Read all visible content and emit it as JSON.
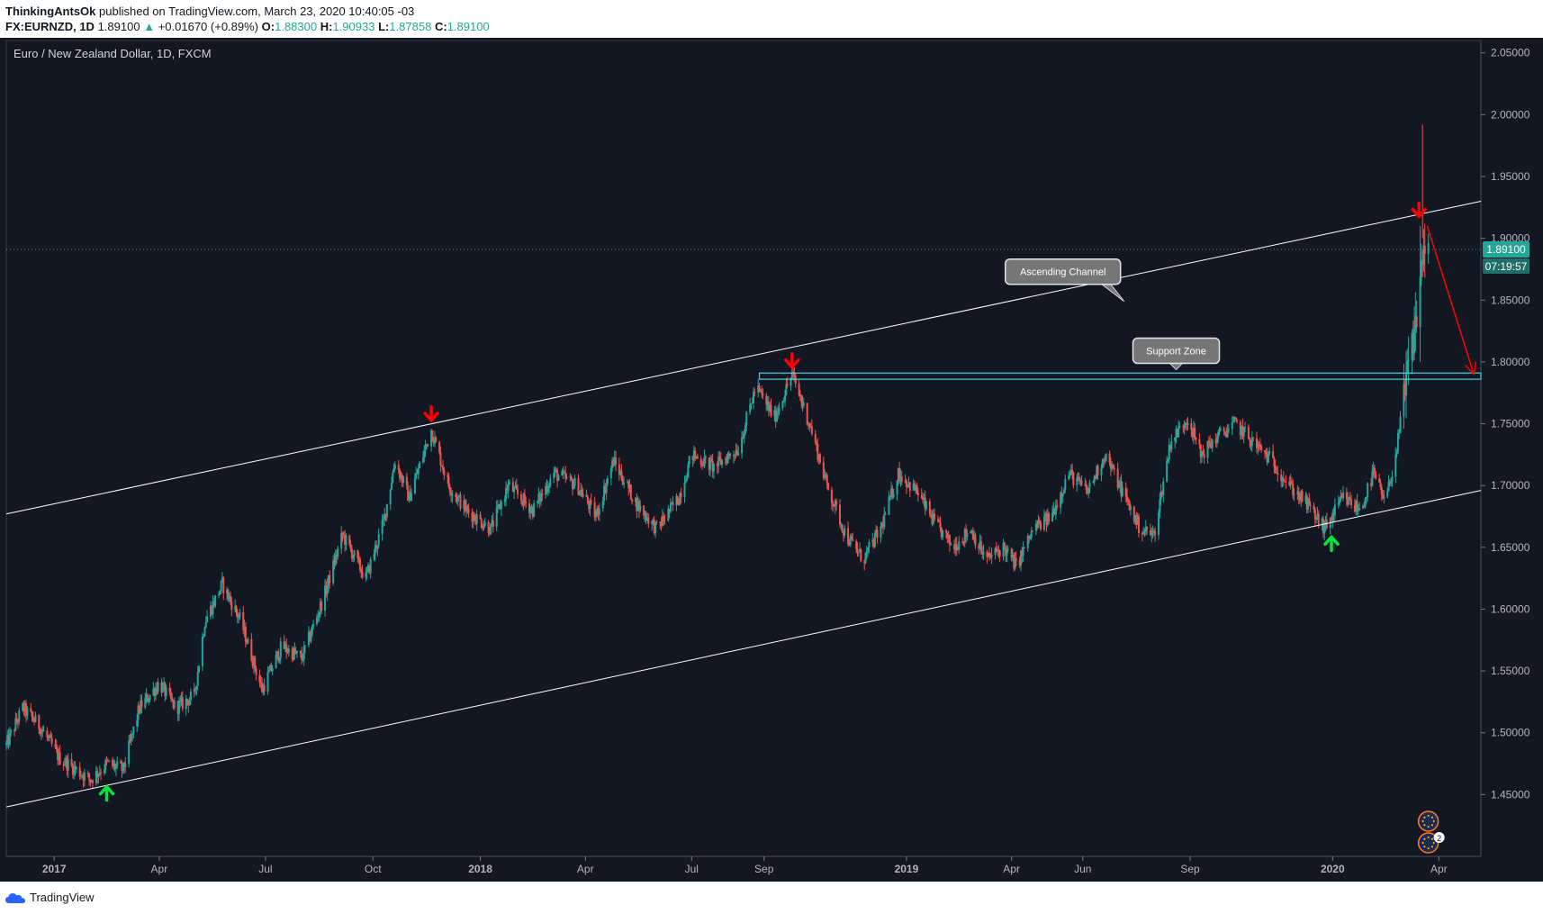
{
  "header": {
    "author": "ThinkingAntsOk",
    "published_text": "published on TradingView.com, March 23, 2020 10:40:05 -03",
    "symbol": "FX:EURNZD, 1D",
    "last": "1.89100",
    "change": "+0.01670 (+0.89%)",
    "o_label": "O:",
    "o_value": "1.88300",
    "h_label": "H:",
    "h_value": "1.90933",
    "l_label": "L:",
    "l_value": "1.87858",
    "c_label": "C:",
    "c_value": "1.89100"
  },
  "footer": {
    "brand": "TradingView"
  },
  "colors": {
    "bg": "#131722",
    "up": "#26a69a",
    "down": "#ef5350",
    "line": "#ffffff",
    "zone": "#4dd0e1",
    "arrow_down": "#ff0000",
    "arrow_up": "#00e640"
  },
  "chart_data": {
    "type": "candlestick",
    "title": "Euro / New Zealand Dollar, 1D, FXCM",
    "ylim": [
      1.4,
      2.06
    ],
    "y_ticks": [
      "2.05000",
      "2.00000",
      "1.95000",
      "1.90000",
      "1.85000",
      "1.80000",
      "1.75000",
      "1.70000",
      "1.65000",
      "1.60000",
      "1.55000",
      "1.50000",
      "1.45000"
    ],
    "x_range": [
      "2016-11-21",
      "2020-05-07"
    ],
    "x_ticks": [
      {
        "label": "2017",
        "date": "2017-01-01"
      },
      {
        "label": "Apr",
        "date": "2017-04-01"
      },
      {
        "label": "Jul",
        "date": "2017-07-01"
      },
      {
        "label": "Oct",
        "date": "2017-10-01"
      },
      {
        "label": "2018",
        "date": "2018-01-01"
      },
      {
        "label": "Apr",
        "date": "2018-04-01"
      },
      {
        "label": "Jul",
        "date": "2018-07-01"
      },
      {
        "label": "Sep",
        "date": "2018-09-01"
      },
      {
        "label": "2019",
        "date": "2019-01-01"
      },
      {
        "label": "Apr",
        "date": "2019-04-01"
      },
      {
        "label": "Jun",
        "date": "2019-06-01"
      },
      {
        "label": "Sep",
        "date": "2019-09-01"
      },
      {
        "label": "2020",
        "date": "2020-01-01"
      },
      {
        "label": "Apr",
        "date": "2020-04-01"
      }
    ],
    "price_path": [
      [
        "2016-11-21",
        1.49
      ],
      [
        "2016-12-05",
        1.52
      ],
      [
        "2016-12-20",
        1.505
      ],
      [
        "2017-01-05",
        1.48
      ],
      [
        "2017-02-01",
        1.462
      ],
      [
        "2017-02-15",
        1.475
      ],
      [
        "2017-03-01",
        1.47
      ],
      [
        "2017-03-15",
        1.52
      ],
      [
        "2017-04-01",
        1.54
      ],
      [
        "2017-04-15",
        1.52
      ],
      [
        "2017-05-01",
        1.53
      ],
      [
        "2017-05-10",
        1.59
      ],
      [
        "2017-05-25",
        1.62
      ],
      [
        "2017-06-10",
        1.59
      ],
      [
        "2017-06-28",
        1.535
      ],
      [
        "2017-07-15",
        1.57
      ],
      [
        "2017-08-01",
        1.56
      ],
      [
        "2017-08-20",
        1.61
      ],
      [
        "2017-09-05",
        1.66
      ],
      [
        "2017-09-25",
        1.625
      ],
      [
        "2017-10-10",
        1.67
      ],
      [
        "2017-10-20",
        1.72
      ],
      [
        "2017-11-01",
        1.69
      ],
      [
        "2017-11-20",
        1.745
      ],
      [
        "2017-12-05",
        1.7
      ],
      [
        "2017-12-20",
        1.68
      ],
      [
        "2018-01-10",
        1.665
      ],
      [
        "2018-01-25",
        1.7
      ],
      [
        "2018-02-15",
        1.68
      ],
      [
        "2018-03-05",
        1.71
      ],
      [
        "2018-03-25",
        1.7
      ],
      [
        "2018-04-10",
        1.675
      ],
      [
        "2018-04-25",
        1.72
      ],
      [
        "2018-05-15",
        1.685
      ],
      [
        "2018-06-01",
        1.665
      ],
      [
        "2018-06-20",
        1.69
      ],
      [
        "2018-07-01",
        1.725
      ],
      [
        "2018-07-20",
        1.715
      ],
      [
        "2018-08-10",
        1.73
      ],
      [
        "2018-08-25",
        1.78
      ],
      [
        "2018-09-10",
        1.755
      ],
      [
        "2018-09-25",
        1.79
      ],
      [
        "2018-10-10",
        1.75
      ],
      [
        "2018-10-25",
        1.7
      ],
      [
        "2018-11-10",
        1.66
      ],
      [
        "2018-11-25",
        1.64
      ],
      [
        "2018-12-10",
        1.665
      ],
      [
        "2018-12-25",
        1.71
      ],
      [
        "2019-01-10",
        1.695
      ],
      [
        "2019-01-25",
        1.67
      ],
      [
        "2019-02-10",
        1.65
      ],
      [
        "2019-02-25",
        1.665
      ],
      [
        "2019-03-10",
        1.64
      ],
      [
        "2019-03-25",
        1.65
      ],
      [
        "2019-04-05",
        1.635
      ],
      [
        "2019-04-20",
        1.665
      ],
      [
        "2019-05-05",
        1.675
      ],
      [
        "2019-05-20",
        1.71
      ],
      [
        "2019-06-05",
        1.695
      ],
      [
        "2019-06-20",
        1.725
      ],
      [
        "2019-07-05",
        1.695
      ],
      [
        "2019-07-20",
        1.665
      ],
      [
        "2019-08-01",
        1.66
      ],
      [
        "2019-08-15",
        1.735
      ],
      [
        "2019-08-30",
        1.755
      ],
      [
        "2019-09-10",
        1.725
      ],
      [
        "2019-09-25",
        1.74
      ],
      [
        "2019-10-10",
        1.75
      ],
      [
        "2019-10-25",
        1.735
      ],
      [
        "2019-11-10",
        1.72
      ],
      [
        "2019-11-25",
        1.7
      ],
      [
        "2019-12-10",
        1.685
      ],
      [
        "2019-12-25",
        1.665
      ],
      [
        "2020-01-10",
        1.69
      ],
      [
        "2020-01-25",
        1.68
      ],
      [
        "2020-02-05",
        1.71
      ],
      [
        "2020-02-15",
        1.685
      ],
      [
        "2020-02-25",
        1.73
      ],
      [
        "2020-03-05",
        1.79
      ],
      [
        "2020-03-12",
        1.83
      ],
      [
        "2020-03-19",
        1.895
      ],
      [
        "2020-03-23",
        1.891
      ]
    ],
    "last_price": "1.89100",
    "countdown": "07:19:57",
    "channel_upper": {
      "from": [
        "2016-11-21",
        1.677
      ],
      "to": [
        "2020-05-07",
        1.93
      ]
    },
    "channel_lower": {
      "from": [
        "2016-11-21",
        1.44
      ],
      "to": [
        "2020-05-07",
        1.696
      ]
    },
    "support_zone": {
      "from": "2018-08-28",
      "to": "2020-05-07",
      "low": 1.786,
      "high": 1.791
    },
    "annotations": [
      {
        "text": "Ascending Channel",
        "date": "2019-05-15",
        "price": 1.873
      },
      {
        "text": "Support Zone",
        "date": "2019-08-20",
        "price": 1.809
      }
    ],
    "down_arrows": [
      [
        "2017-11-20",
        1.757
      ],
      [
        "2018-09-25",
        1.8
      ],
      [
        "2020-03-15",
        1.922
      ]
    ],
    "up_arrows": [
      [
        "2017-02-15",
        1.452
      ],
      [
        "2019-12-31",
        1.654
      ]
    ],
    "projection": {
      "from": [
        "2020-03-22",
        1.91
      ],
      "to": [
        "2020-05-01",
        1.79
      ]
    },
    "event_badge_count": "2"
  }
}
